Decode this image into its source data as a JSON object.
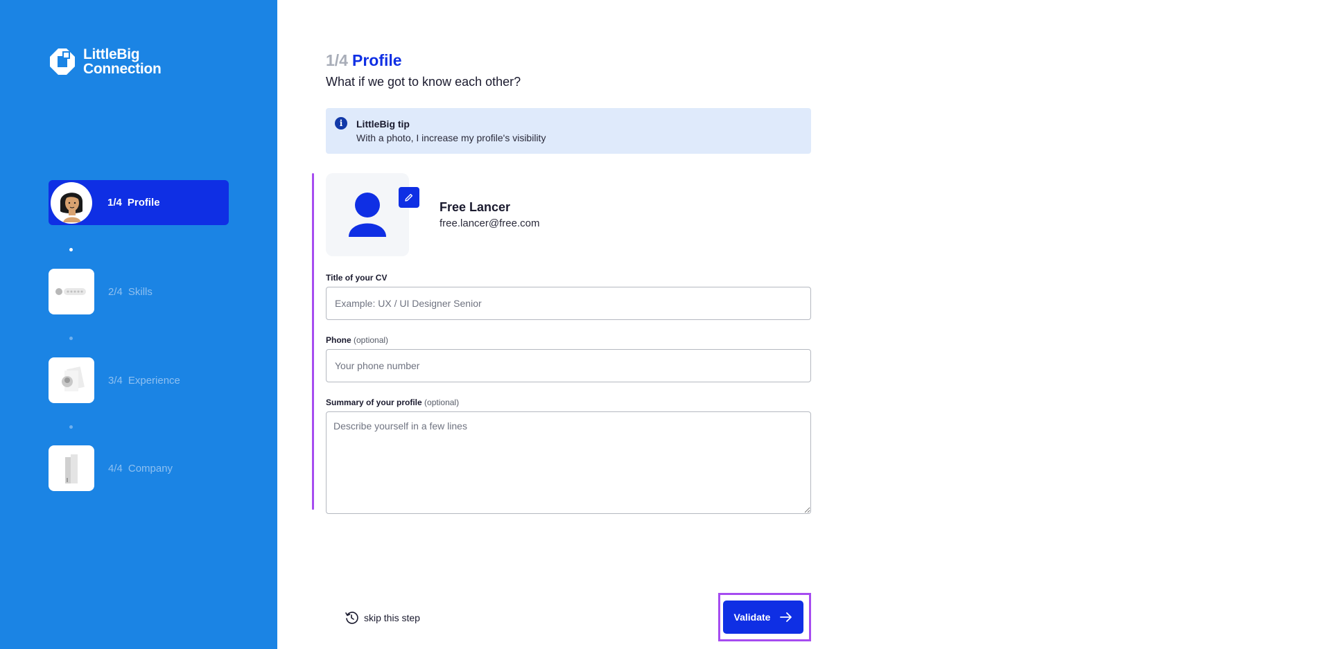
{
  "brand": {
    "line1": "LittleBig",
    "line2": "Connection"
  },
  "steps": [
    {
      "number": "1/4",
      "label": "Profile",
      "active": true
    },
    {
      "number": "2/4",
      "label": "Skills",
      "active": false
    },
    {
      "number": "3/4",
      "label": "Experience",
      "active": false
    },
    {
      "number": "4/4",
      "label": "Company",
      "active": false
    }
  ],
  "header": {
    "step_count": "1/4",
    "title": "Profile",
    "subtitle": "What if we got to know each other?"
  },
  "tip": {
    "icon": "info-icon",
    "title": "LittleBig tip",
    "text": "With a photo, I increase my profile's visibility"
  },
  "user": {
    "name": "Free Lancer",
    "email": "free.lancer@free.com"
  },
  "form": {
    "cv_title_label": "Title of your CV",
    "cv_title_placeholder": "Example: UX / UI Designer Senior",
    "cv_title_value": "",
    "phone_label": "Phone",
    "phone_optional": "(optional)",
    "phone_placeholder": "Your phone number",
    "phone_value": "",
    "summary_label": "Summary of your profile",
    "summary_optional": "(optional)",
    "summary_placeholder": "Describe yourself in a few lines",
    "summary_value": ""
  },
  "actions": {
    "skip_label": "skip this step",
    "validate_label": "Validate"
  },
  "colors": {
    "sidebar": "#1b84e4",
    "accent": "#0f2fe4",
    "highlight": "#a64cf0",
    "tip_bg": "#dfeafb"
  }
}
